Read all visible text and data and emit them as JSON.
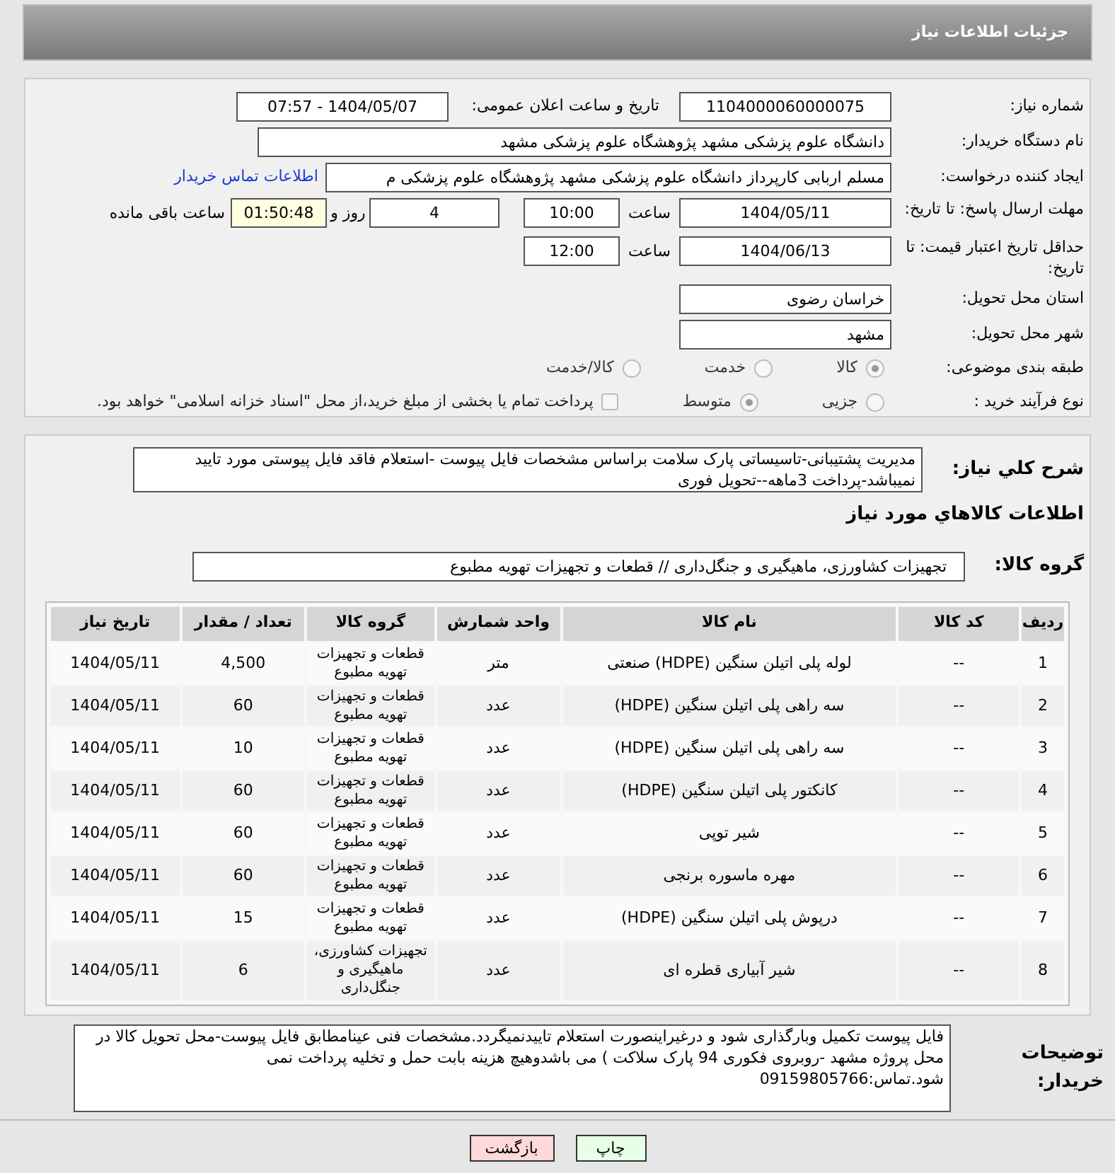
{
  "header": {
    "title": "جزئیات اطلاعات نیاز"
  },
  "need_number": {
    "label": "شماره نیاز:",
    "value": "1104000060000075"
  },
  "announce": {
    "label": "تاریخ و ساعت اعلان عمومی:",
    "value": "1404/05/07 - 07:57"
  },
  "buyer_org": {
    "label": "نام دستگاه خریدار:",
    "value": "دانشگاه علوم پزشکی مشهد   پژوهشگاه علوم پزشکی مشهد"
  },
  "requester": {
    "label": "ایجاد کننده درخواست:",
    "value": "مسلم اربابی کارپرداز دانشگاه علوم پزشکی مشهد   پژوهشگاه علوم پزشکی م",
    "link": "اطلاعات تماس خریدار"
  },
  "deadline": {
    "label": "مهلت ارسال پاسخ: تا تاریخ:",
    "date": "1404/05/11",
    "time_label": "ساعت",
    "time": "10:00",
    "days": "4",
    "days_label": "روز و",
    "remaining": "01:50:48",
    "remaining_label": "ساعت باقی مانده"
  },
  "validity": {
    "label": "حداقل تاریخ اعتبار قیمت: تا تاریخ:",
    "date": "1404/06/13",
    "time_label": "ساعت",
    "time": "12:00"
  },
  "province": {
    "label": "استان محل تحویل:",
    "value": "خراسان رضوی"
  },
  "city": {
    "label": "شهر محل تحویل:",
    "value": "مشهد"
  },
  "category": {
    "label": "طبقه بندی موضوعی:",
    "options": [
      {
        "label": "کالا",
        "selected": true
      },
      {
        "label": "خدمت",
        "selected": false
      },
      {
        "label": "کالا/خدمت",
        "selected": false
      }
    ]
  },
  "process": {
    "label": "نوع فرآیند خرید :",
    "options": [
      {
        "label": "جزیی",
        "selected": false
      },
      {
        "label": "متوسط",
        "selected": true
      }
    ],
    "payment": {
      "label": "پرداخت تمام یا بخشی از مبلغ خرید،از محل \"اسناد خزانه اسلامی\" خواهد بود.",
      "checked": false
    }
  },
  "summary": {
    "label": "شرح کلي نياز:",
    "value": "مدیریت پشتیبانی-تاسیساتی پارک سلامت براساس مشخصات فایل پیوست -استعلام فاقد فایل پیوستی مورد تایید نمیباشد-پرداخت 3ماهه--تحویل فوری"
  },
  "goods_heading": "اطلاعات کالاهاي مورد نياز",
  "goods_group": {
    "label": "گروه کالا:",
    "value": "تجهیزات کشاورزی، ماهیگیری و جنگل‌داری //  قطعات و تجهیزات تهویه مطبوع"
  },
  "table": {
    "columns": [
      "ردیف",
      "کد کالا",
      "نام کالا",
      "واحد شمارش",
      "گروه کالا",
      "تعداد / مقدار",
      "تاریخ نیاز"
    ],
    "rows": [
      [
        "1",
        "--",
        "لوله پلی اتیلن سنگین (HDPE) صنعتی",
        "متر",
        "قطعات و تجهیزات تهویه مطبوع",
        "4,500",
        "1404/05/11"
      ],
      [
        "2",
        "--",
        "سه راهی پلی اتیلن سنگین (HDPE)",
        "عدد",
        "قطعات و تجهیزات تهویه مطبوع",
        "60",
        "1404/05/11"
      ],
      [
        "3",
        "--",
        "سه راهی پلی اتیلن سنگین (HDPE)",
        "عدد",
        "قطعات و تجهیزات تهویه مطبوع",
        "10",
        "1404/05/11"
      ],
      [
        "4",
        "--",
        "کانکتور پلی اتیلن سنگین (HDPE)",
        "عدد",
        "قطعات و تجهیزات تهویه مطبوع",
        "60",
        "1404/05/11"
      ],
      [
        "5",
        "--",
        "شیر توپی",
        "عدد",
        "قطعات و تجهیزات تهویه مطبوع",
        "60",
        "1404/05/11"
      ],
      [
        "6",
        "--",
        "مهره ماسوره برنجی",
        "عدد",
        "قطعات و تجهیزات تهویه مطبوع",
        "60",
        "1404/05/11"
      ],
      [
        "7",
        "--",
        "درپوش پلی اتیلن سنگین (HDPE)",
        "عدد",
        "قطعات و تجهیزات تهویه مطبوع",
        "15",
        "1404/05/11"
      ],
      [
        "8",
        "--",
        "شیر آبیاری قطره ای",
        "عدد",
        "تجهیزات کشاورزی، ماهیگیری و جنگل‌داری",
        "6",
        "1404/05/11"
      ]
    ]
  },
  "buyer_notes": {
    "label": "توضیحات خریدار:",
    "value": "فایل پیوست تکمیل وبارگذاری شود و درغیراینصورت استعلام تاییدنمیگردد.مشخصات فنی عینامطابق فایل پیوست-محل تحویل کالا در محل پروژه  مشهد -روبروی فکوری 94 پارک سلاکت ) می باشدوهیچ هزینه بابت حمل و تخلیه پرداخت نمی شود.تماس:09159805766"
  },
  "buttons": [
    {
      "label": "چاپ",
      "kind": "print"
    },
    {
      "label": "بازگشت",
      "kind": "back"
    }
  ]
}
